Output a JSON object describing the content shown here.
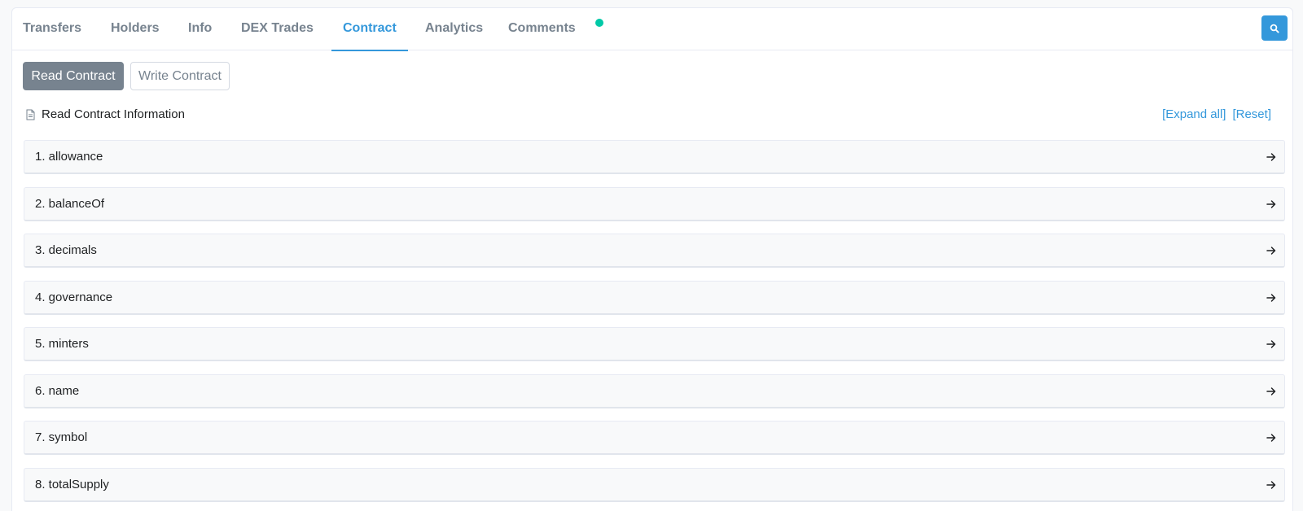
{
  "tabs": [
    {
      "label": "Transfers",
      "active": false
    },
    {
      "label": "Holders",
      "active": false
    },
    {
      "label": "Info",
      "active": false
    },
    {
      "label": "DEX Trades",
      "active": false
    },
    {
      "label": "Contract",
      "active": true
    },
    {
      "label": "Analytics",
      "active": false
    },
    {
      "label": "Comments",
      "active": false
    }
  ],
  "search_icon": "search-icon",
  "subtabs": {
    "read_label": "Read Contract",
    "write_label": "Write Contract"
  },
  "info": {
    "title": "Read Contract Information",
    "icon": "document-icon",
    "expand_label": "[Expand all]",
    "reset_label": "[Reset]"
  },
  "functions": [
    {
      "label": "1. allowance"
    },
    {
      "label": "2. balanceOf"
    },
    {
      "label": "3. decimals"
    },
    {
      "label": "4. governance"
    },
    {
      "label": "5. minters"
    },
    {
      "label": "6. name"
    },
    {
      "label": "7. symbol"
    },
    {
      "label": "8. totalSupply"
    }
  ],
  "colors": {
    "accent": "#3498db",
    "muted": "#77838f",
    "notification_dot": "#00c9a7"
  }
}
